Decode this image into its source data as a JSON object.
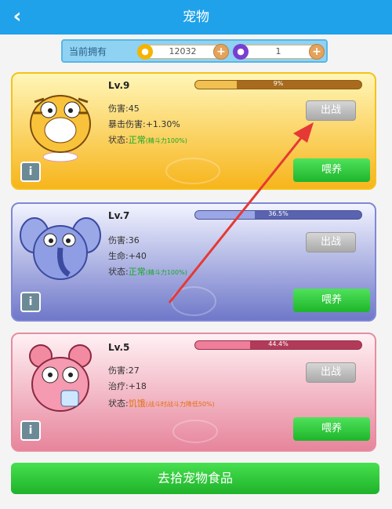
{
  "header": {
    "title": "宠物",
    "back_icon": "back-arrow-icon"
  },
  "wallet": {
    "label": "当前拥有",
    "coins": "12032",
    "gems": "1",
    "coin_icon": "gold-coin-icon",
    "gem_icon": "purple-gem-icon",
    "plus_icon": "plus-icon"
  },
  "pets": [
    {
      "level": "Lv.9",
      "exp_text": "9%",
      "exp_fraction": 0.25,
      "stat1": "伤害:45",
      "stat2": "暴击伤害:+1.30%",
      "status_label": "状态:",
      "status_value": "正常",
      "status_note": "(精斗力100%)",
      "out_label": "出战",
      "feed_label": "喂养",
      "info": "i",
      "colors": {
        "bg1": "#ffe066",
        "bg2": "#f6b21c",
        "bar": "#c8842a",
        "bar_bg": "#a86a1c"
      }
    },
    {
      "level": "Lv.7",
      "exp_text": "36.5%",
      "exp_fraction": 0.36,
      "stat1": "伤害:36",
      "stat2": "生命:+40",
      "status_label": "状态:",
      "status_value": "正常",
      "status_note": "(精斗力100%)",
      "out_label": "出战",
      "feed_label": "喂养",
      "info": "i",
      "colors": {
        "bg1": "#e8ecff",
        "bg2": "#6f78c9",
        "bar": "#8a95d6",
        "bar_bg": "#5a63b0"
      }
    },
    {
      "level": "Lv.5",
      "exp_text": "44.4%",
      "exp_fraction": 0.33,
      "stat1": "伤害:27",
      "stat2": "治疗:+18",
      "status_label": "状态:",
      "status_value": "饥饿",
      "status_note": "(战斗时战斗力降低50%)",
      "out_label": "出战",
      "feed_label": "喂养",
      "info": "i",
      "colors": {
        "bg1": "#ffe3ea",
        "bg2": "#e47a93",
        "bar": "#e5567a",
        "bar_bg": "#b23a59"
      }
    }
  ],
  "footer": {
    "buy_food_label": "去拾宠物食品"
  }
}
